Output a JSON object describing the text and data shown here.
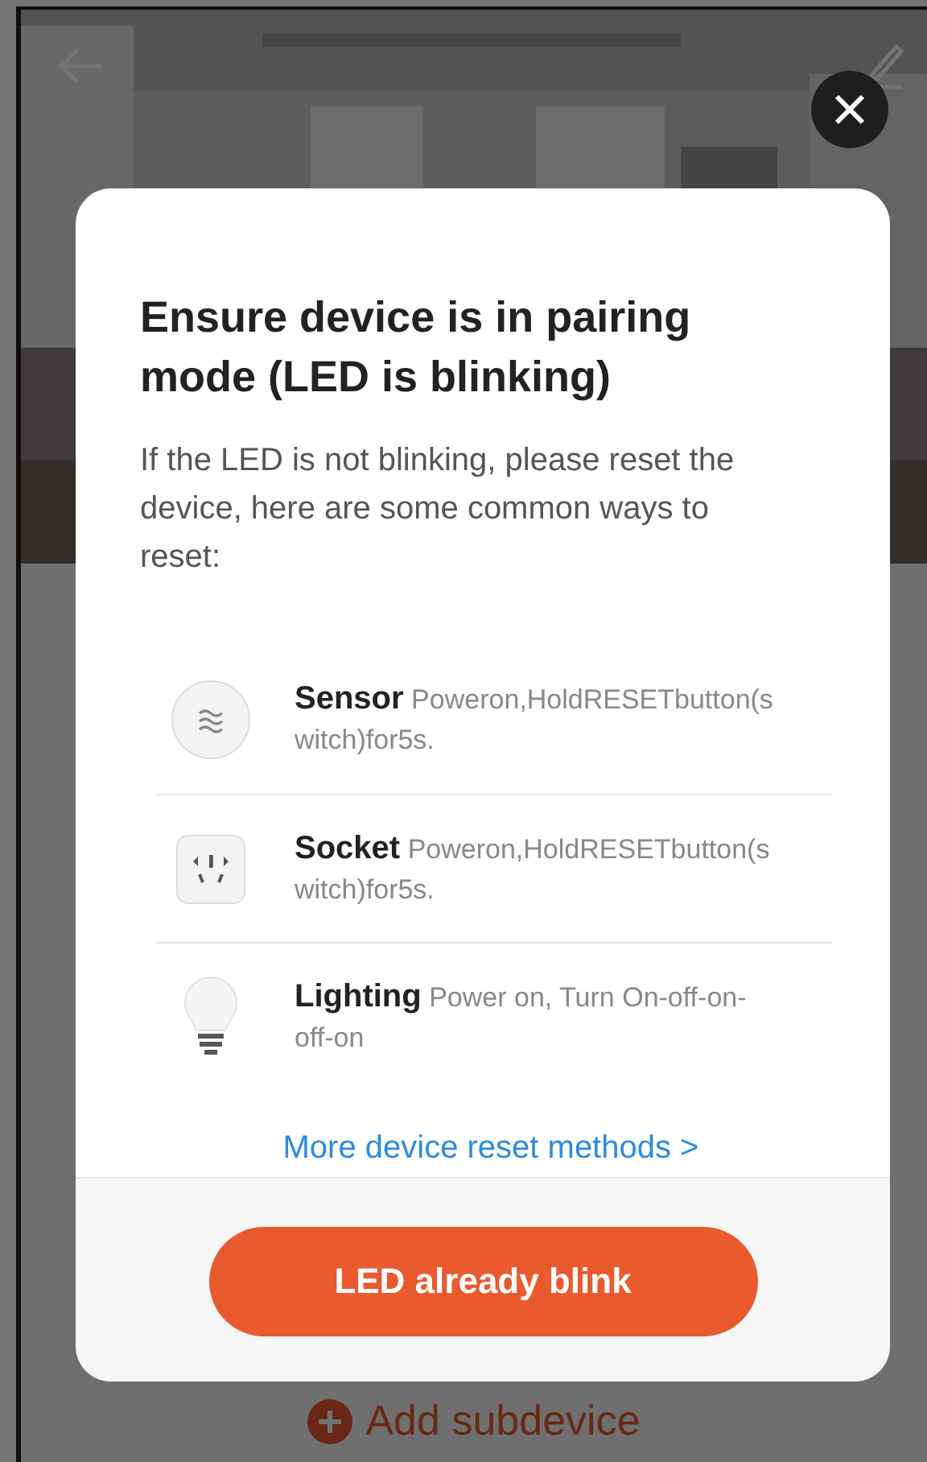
{
  "background_page": {
    "add_button": "Add subdevice"
  },
  "dialog": {
    "title": "Ensure device is in pairing mode (LED is blinking)",
    "description": "If the LED is not blinking, please reset the device, here are some common ways to reset:",
    "methods": [
      {
        "kind": "sensor",
        "name": "Sensor",
        "instruction": "Poweron,HoldRESETbutton(switch)for5s."
      },
      {
        "kind": "socket",
        "name": "Socket",
        "instruction": "Poweron,HoldRESETbutton(switch)for5s."
      },
      {
        "kind": "lighting",
        "name": "Lighting",
        "instruction": "Power on, Turn On-off-on-off-on"
      }
    ],
    "more_link": "More device reset methods >",
    "confirm_button": "LED already blink"
  }
}
